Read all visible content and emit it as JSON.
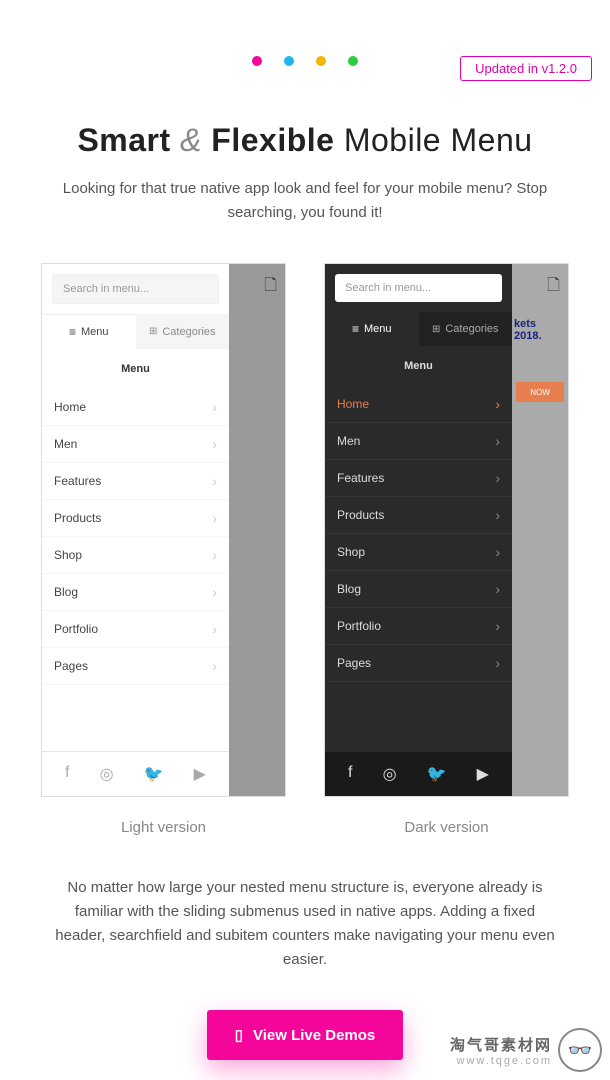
{
  "badge": "Updated in v1.2.0",
  "dots": [
    "#f5069a",
    "#1eb8f0",
    "#f5b400",
    "#2ecc40"
  ],
  "heading": {
    "word1": "Smart",
    "amp": "&",
    "word2": "Flexible",
    "rest": "Mobile Menu"
  },
  "subtitle": "Looking for that true native app look and feel for your mobile menu? Stop searching, you found it!",
  "search_placeholder": "Search in menu...",
  "tabs": {
    "menu": "Menu",
    "categories": "Categories"
  },
  "menu_label": "Menu",
  "menu_items": [
    "Home",
    "Men",
    "Features",
    "Products",
    "Shop",
    "Blog",
    "Portfolio",
    "Pages"
  ],
  "version_labels": {
    "light": "Light version",
    "dark": "Dark version"
  },
  "bottom_text": "No matter how large your nested menu structure is, everyone already is familiar with the sliding submenus used in native apps. Adding a fixed header, searchfield and subitem counters make navigating your menu even easier.",
  "cta": "View Live Demos",
  "bg_promo": {
    "line1": "kets",
    "line2": "2018.",
    "btn": "NOW"
  },
  "watermark": {
    "line1": "淘气哥素材网",
    "line2": "www.tqge.com"
  }
}
